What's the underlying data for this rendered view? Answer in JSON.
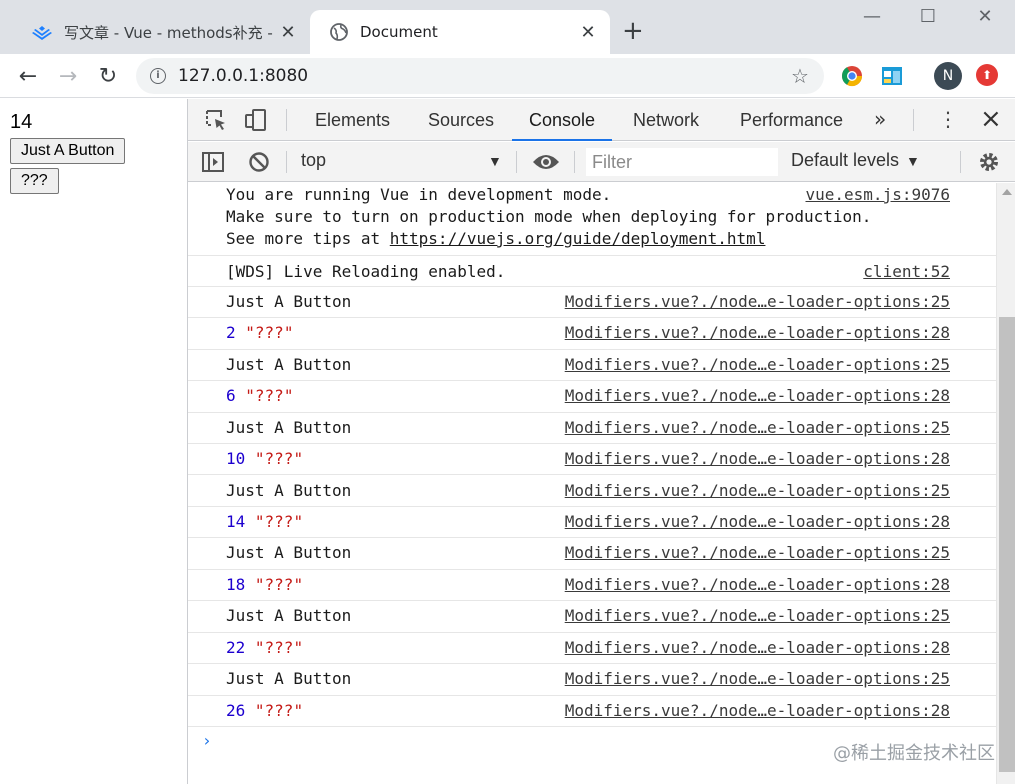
{
  "browser": {
    "tabs": [
      {
        "title": "写文章 - Vue - methods补充 - 掘",
        "icon": "vue-juejin-icon"
      },
      {
        "title": "Document",
        "icon": "globe-icon"
      }
    ],
    "url": "127.0.0.1:8080",
    "profile_initial": "N"
  },
  "page": {
    "counter": "14",
    "buttons": [
      "Just A Button",
      "???"
    ]
  },
  "devtools": {
    "tabs": [
      "Elements",
      "Sources",
      "Console",
      "Network",
      "Performance"
    ],
    "active_tab": "Console",
    "context": "top",
    "filter_placeholder": "Filter",
    "levels": "Default levels"
  },
  "console": {
    "vue_notice": {
      "lines": [
        "You are running Vue in development mode.",
        "Make sure to turn on production mode when deploying for production.",
        "See more tips at "
      ],
      "link": "https://vuejs.org/guide/deployment.html",
      "source": "vue.esm.js:9076"
    },
    "wds": {
      "text": "[WDS] Live Reloading enabled.",
      "source": "client:52"
    },
    "logs": [
      {
        "text": "Just A Button",
        "source": "Modifiers.vue?./node…e-loader-options:25"
      },
      {
        "num": "2",
        "str": "\"???\"",
        "source": "Modifiers.vue?./node…e-loader-options:28"
      },
      {
        "text": "Just A Button",
        "source": "Modifiers.vue?./node…e-loader-options:25"
      },
      {
        "num": "6",
        "str": "\"???\"",
        "source": "Modifiers.vue?./node…e-loader-options:28"
      },
      {
        "text": "Just A Button",
        "source": "Modifiers.vue?./node…e-loader-options:25"
      },
      {
        "num": "10",
        "str": "\"???\"",
        "source": "Modifiers.vue?./node…e-loader-options:28"
      },
      {
        "text": "Just A Button",
        "source": "Modifiers.vue?./node…e-loader-options:25"
      },
      {
        "num": "14",
        "str": "\"???\"",
        "source": "Modifiers.vue?./node…e-loader-options:28"
      },
      {
        "text": "Just A Button",
        "source": "Modifiers.vue?./node…e-loader-options:25"
      },
      {
        "num": "18",
        "str": "\"???\"",
        "source": "Modifiers.vue?./node…e-loader-options:28"
      },
      {
        "text": "Just A Button",
        "source": "Modifiers.vue?./node…e-loader-options:25"
      },
      {
        "num": "22",
        "str": "\"???\"",
        "source": "Modifiers.vue?./node…e-loader-options:28"
      },
      {
        "text": "Just A Button",
        "source": "Modifiers.vue?./node…e-loader-options:25"
      },
      {
        "num": "26",
        "str": "\"???\"",
        "source": "Modifiers.vue?./node…e-loader-options:28"
      }
    ],
    "prompt": "›"
  },
  "watermark": "@稀土掘金技术社区",
  "colors": {
    "accent": "#1a73e8",
    "number": "#1c00cf",
    "string": "#c41a16"
  }
}
